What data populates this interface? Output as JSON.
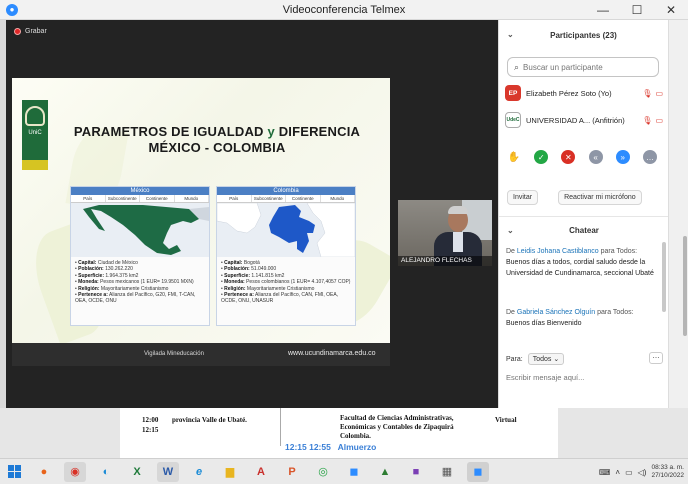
{
  "window": {
    "title": "Videoconferencia Telmex",
    "minimize": "—",
    "maximize": "☐",
    "close": "✕"
  },
  "meeting": {
    "recording_label": "Grabar"
  },
  "slide": {
    "logo_text": "UniC",
    "title_line1": "PARAMETROS DE IGUALDAD",
    "title_connector": "y",
    "title_line1b": "DIFERENCIA",
    "title_line2": "MÉXICO - COLOMBIA",
    "tabs": [
      "País",
      "Subcontinente",
      "Continente",
      "Mundo"
    ],
    "mexico": {
      "header": "México",
      "rows": [
        {
          "label": "Capital:",
          "value": "Ciudad de México"
        },
        {
          "label": "Población:",
          "value": "130.262.220"
        },
        {
          "label": "Superficie:",
          "value": "1.964.375 km2"
        },
        {
          "label": "Moneda:",
          "value": "Pesos mexicanos (1 EUR= 19.9501 MXN)"
        },
        {
          "label": "Religión:",
          "value": "Mayoritariamente Cristianismo"
        },
        {
          "label": "Pertenece a:",
          "value": "Alianza del Pacífico, G20, FMI, T-CAN, OEA, OCDE, ONU"
        }
      ]
    },
    "colombia": {
      "header": "Colombia",
      "rows": [
        {
          "label": "Capital:",
          "value": "Bogotá"
        },
        {
          "label": "Población:",
          "value": "51.049.000"
        },
        {
          "label": "Superficie:",
          "value": "1.141.815 km2"
        },
        {
          "label": "Moneda:",
          "value": "Pesos colombianos (1 EUR= 4.107,4057 COP)"
        },
        {
          "label": "Religión:",
          "value": "Mayoritariamente Cristianismo"
        },
        {
          "label": "Pertenece a:",
          "value": "Alianza del Pacífico, CAN, FMI, OEA, OCDE, ONU, UNASUR"
        }
      ]
    },
    "footer_left": "Vigilada Mineducación",
    "footer_right": "www.ucundinamarca.edu.co"
  },
  "video": {
    "name": "ALEJANDRO FLECHAS"
  },
  "participants": {
    "title": "Participantes (23)",
    "search_placeholder": "Buscar un participante",
    "list": [
      {
        "initials": "EP",
        "name": "Elizabeth Pérez Soto (Yo)"
      },
      {
        "initials": "UdeC",
        "name": "UNIVERSIDAD A... (Anfitrión)"
      }
    ],
    "invite_label": "Invitar",
    "unmute_label": "Reactivar mi micrófono"
  },
  "chat": {
    "title": "Chatear",
    "messages": [
      {
        "from_prefix": "De",
        "from": "Leidis Johana Castiblanco",
        "to_text": "para Todos:",
        "text": "Buenos días a todos, cordial saludo desde la Universidad de Cundinamarca, seccional Ubaté"
      },
      {
        "from_prefix": "De",
        "from": "Gabriela Sánchez Olguín",
        "to_text": "para Todos:",
        "text": "Buenos días Bienvenido"
      }
    ],
    "to_label": "Para:",
    "to_value": "Todos",
    "input_placeholder": "Escribir mensaje aquí..."
  },
  "document": {
    "time_a": "12:00",
    "time_b": "12:15",
    "place_a": "provincia Valle de Ubaté.",
    "faculty_line1": "Facultad de Ciencias Administrativas,",
    "faculty_line2": "Económicas y Contables de Zipaquirá",
    "faculty_line3": "Colombia.",
    "mode": "Virtual",
    "lunch_time": "12:15 12:55",
    "lunch_label": "Almuerzo"
  },
  "taskbar": {
    "time": "08:33 a. m.",
    "date": "27/10/2022"
  }
}
